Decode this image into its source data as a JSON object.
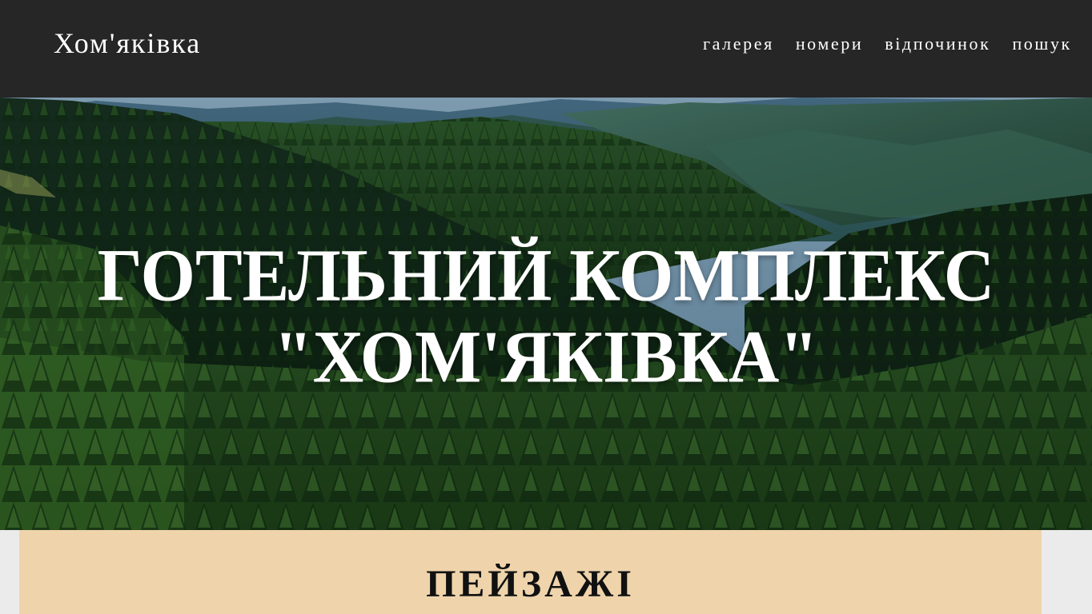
{
  "header": {
    "logo": "Хом'яківка",
    "nav": [
      {
        "label": "галерея"
      },
      {
        "label": "номери"
      },
      {
        "label": "відпочинок"
      },
      {
        "label": "пошук"
      }
    ]
  },
  "hero": {
    "title_line1": "ГОТЕЛЬНИЙ КОМПЛЕКС",
    "title_line2": "\"ХОМ'ЯКІВКА\"",
    "image": "forested-mountains-photo"
  },
  "section": {
    "heading": "ПЕЙЗАЖІ"
  },
  "colors": {
    "header_bg": "#262626",
    "section_bg": "#efd4ab",
    "page_bg": "#ebebeb"
  }
}
